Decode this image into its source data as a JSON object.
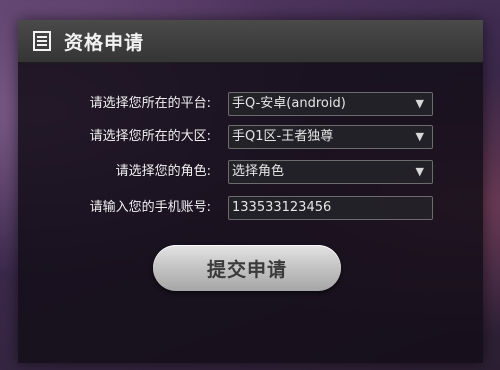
{
  "dialog": {
    "title": "资格申请",
    "title_icon": "document-icon"
  },
  "form": {
    "platform": {
      "label": "请选择您所在的平台:",
      "value": "手Q-安卓(android)"
    },
    "region": {
      "label": "请选择您所在的大区:",
      "value": "手Q1区-王者独尊"
    },
    "role": {
      "label": "请选择您的角色:",
      "value": "选择角色"
    },
    "phone": {
      "label": "请输入您的手机账号:",
      "value": "133533123456"
    },
    "dropdown_icon": "▼"
  },
  "submit": {
    "label": "提交申请"
  }
}
